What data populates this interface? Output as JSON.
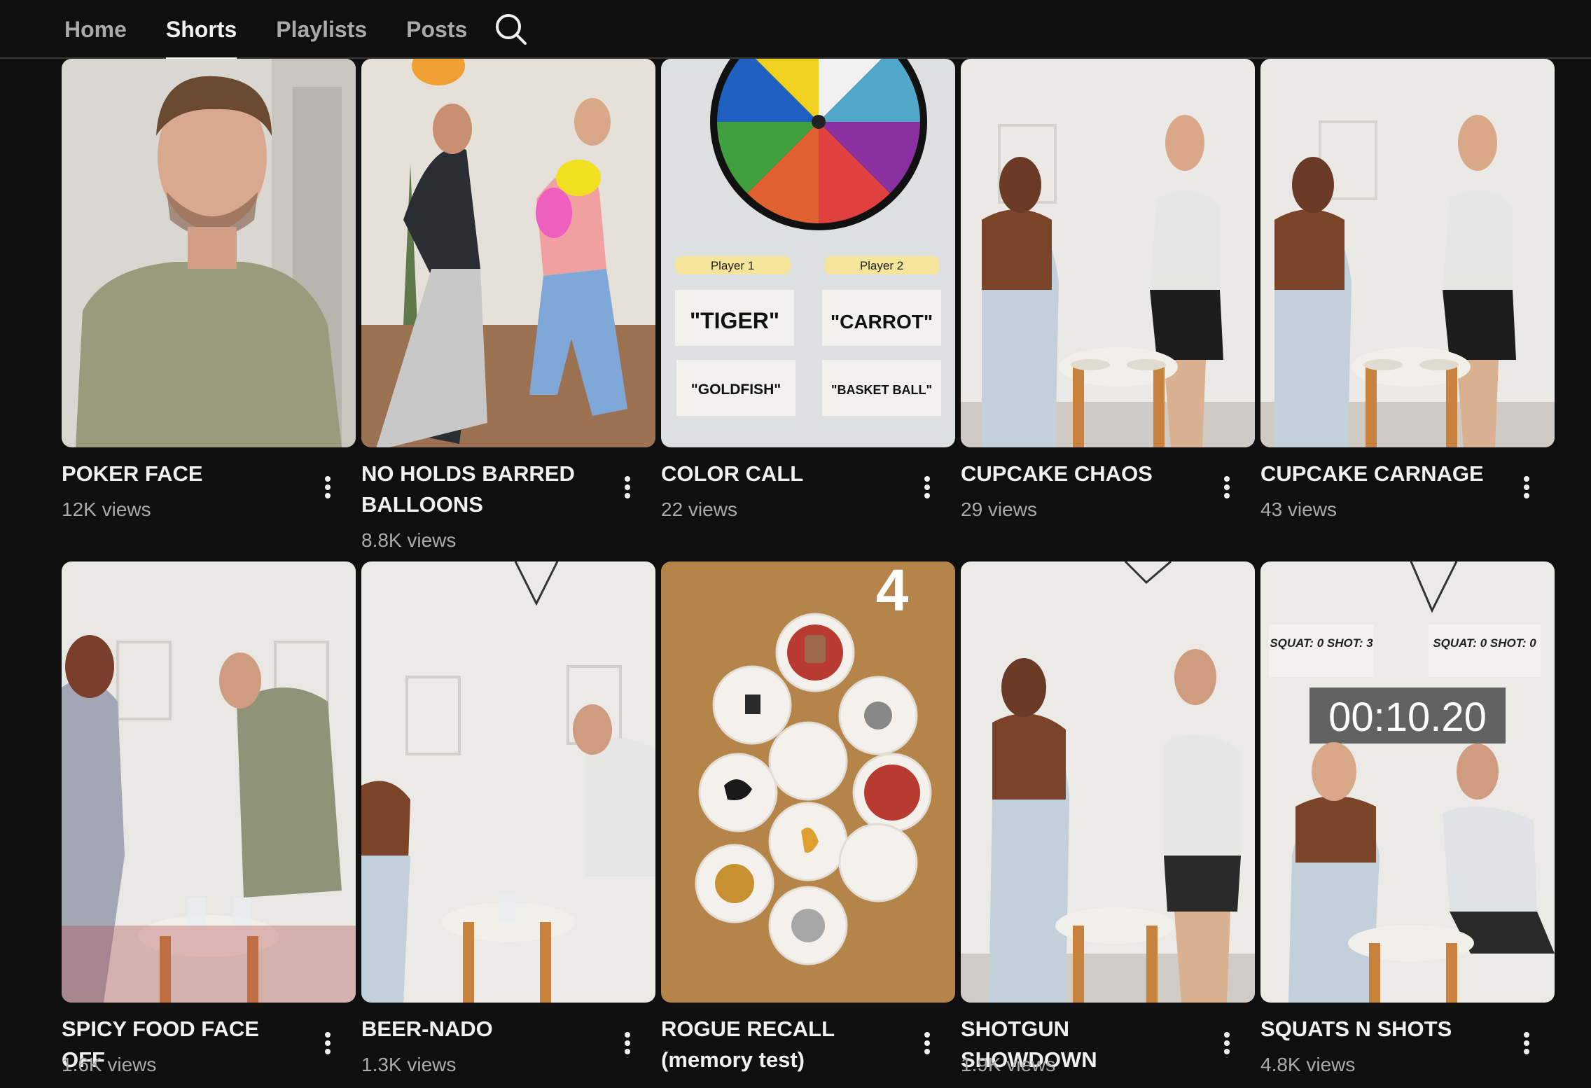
{
  "tabs": [
    {
      "label": "Home",
      "active": false
    },
    {
      "label": "Shorts",
      "active": true
    },
    {
      "label": "Playlists",
      "active": false
    },
    {
      "label": "Posts",
      "active": false
    }
  ],
  "search_icon": "search-icon",
  "more_icon": "more-vert-icon",
  "shorts": [
    {
      "title": "POKER FACE",
      "views": "12K views"
    },
    {
      "title": "NO HOLDS BARRED BALLOONS",
      "views": "8.8K views"
    },
    {
      "title": "COLOR CALL",
      "views": "22 views",
      "overlay": {
        "player1": "Player 1",
        "player2": "Player 2",
        "word1": "\"TIGER\"",
        "word2": "\"CARROT\"",
        "word3": "\"GOLDFISH\"",
        "word4": "\"BASKET BALL\""
      }
    },
    {
      "title": "CUPCAKE CHAOS",
      "views": "29 views"
    },
    {
      "title": "CUPCAKE CARNAGE",
      "views": "43 views"
    },
    {
      "title": "SPICY FOOD FACE OFF",
      "views": "1.6K views"
    },
    {
      "title": "BEER-NADO",
      "views": "1.3K views"
    },
    {
      "title": "ROGUE RECALL (memory test)",
      "views": "",
      "overlay": {
        "number": "4"
      }
    },
    {
      "title": "SHOTGUN SHOWDOWN",
      "views": "1.9K views"
    },
    {
      "title": "SQUATS N SHOTS",
      "views": "4.8K views",
      "overlay": {
        "score_left": "SQUAT: 0 SHOT: 3",
        "score_right": "SQUAT: 0 SHOT: 0",
        "timer": "00:10.20"
      }
    }
  ]
}
